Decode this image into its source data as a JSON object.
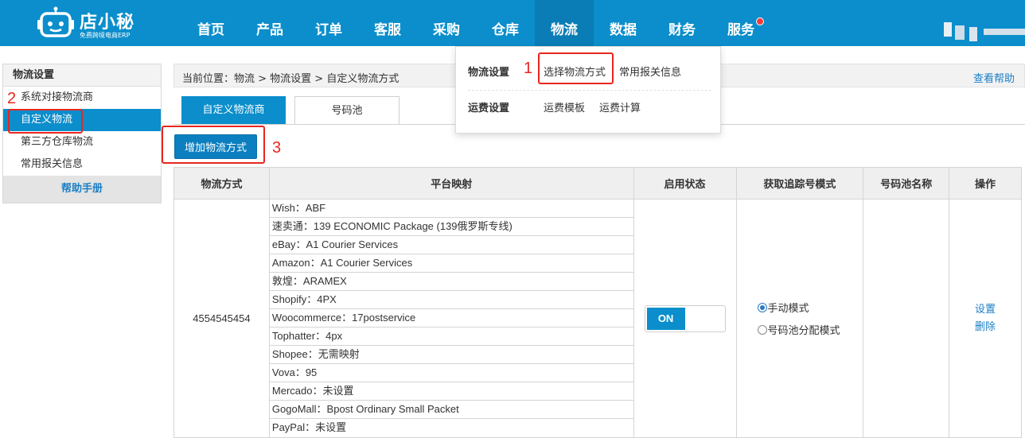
{
  "header": {
    "brand": "店小秘",
    "slogan": "免费跨境电商ERP",
    "nav": [
      "首页",
      "产品",
      "订单",
      "客服",
      "采购",
      "仓库",
      "物流",
      "数据",
      "财务",
      "服务"
    ],
    "active_nav": "物流"
  },
  "dropdown": {
    "group1_title": "物流设置",
    "group1_links": [
      "选择物流方式",
      "常用报关信息"
    ],
    "group2_title": "运费设置",
    "group2_links": [
      "运费模板",
      "运费计算"
    ]
  },
  "sidebar": {
    "title": "物流设置",
    "items": [
      "系统对接物流商",
      "自定义物流",
      "第三方仓库物流",
      "常用报关信息"
    ],
    "active_item": "自定义物流",
    "help": "帮助手册"
  },
  "breadcrumb": {
    "text": "当前位置：物流 > 物流设置 > 自定义物流方式",
    "help_link": "查看帮助"
  },
  "tabs": [
    "自定义物流商",
    "号码池"
  ],
  "add_button": "增加物流方式",
  "table": {
    "headers": [
      "物流方式",
      "平台映射",
      "启用状态",
      "获取追踪号模式",
      "号码池名称",
      "操作"
    ],
    "row": {
      "method": "4554545454",
      "mappings": [
        "Wish：ABF",
        "速卖通：139 ECONOMIC Package (139俄罗斯专线)",
        "eBay：A1 Courier Services",
        "Amazon：A1 Courier Services",
        "敦煌：ARAMEX",
        "Shopify：4PX",
        "Woocommerce：17postservice",
        "Tophatter：4px",
        "Shopee：无需映射",
        "Vova：95",
        "Mercado：未设置",
        "GogoMall：Bpost Ordinary Small Packet",
        "PayPal：未设置"
      ],
      "status": "ON",
      "tracking_modes": [
        "手动模式",
        "号码池分配模式"
      ],
      "tracking_selected": "手动模式",
      "pool_name": "",
      "actions": [
        "设置",
        "删除"
      ]
    }
  },
  "annotations": [
    "1",
    "2",
    "3"
  ],
  "colors": {
    "primary": "#0b8ecb",
    "link": "#1b7fc4",
    "annotation": "#e8261e"
  }
}
